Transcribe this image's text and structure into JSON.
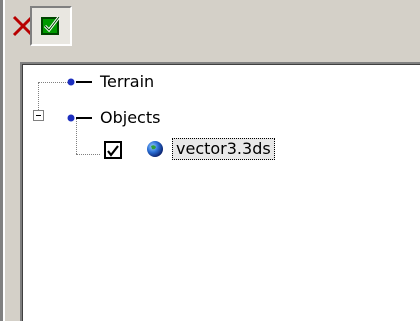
{
  "toolbar": {
    "delete_icon": "close-x-icon",
    "check_icon": "check-all-icon",
    "colors": {
      "delete": "#b80000",
      "check_fill": "#00a000"
    }
  },
  "tree": {
    "nodes": [
      {
        "label": "Terrain",
        "icon": "node-dot-icon"
      },
      {
        "label": "Objects",
        "icon": "node-dot-icon",
        "expanded": true
      },
      {
        "label": "vector3.3ds",
        "icon": "globe-icon",
        "checked": true,
        "selected": true
      }
    ]
  }
}
